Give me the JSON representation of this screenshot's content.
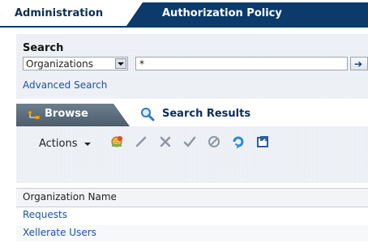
{
  "tabs": {
    "administration": "Administration",
    "authorization_policy": "Authorization Policy"
  },
  "search": {
    "title": "Search",
    "scope_value": "Organizations",
    "query_value": "*",
    "advanced_link": "Advanced Search"
  },
  "subtabs": {
    "browse": "Browse",
    "search_results": "Search Results"
  },
  "toolbar": {
    "actions_label": "Actions"
  },
  "table": {
    "columns": [
      "Organization Name"
    ],
    "rows": [
      {
        "organization_name": "Requests"
      },
      {
        "organization_name": "Xellerate Users"
      }
    ]
  },
  "colors": {
    "brand_blue": "#0b3a6b",
    "link": "#1b52a6",
    "panel_bg": "#e9edf3"
  }
}
